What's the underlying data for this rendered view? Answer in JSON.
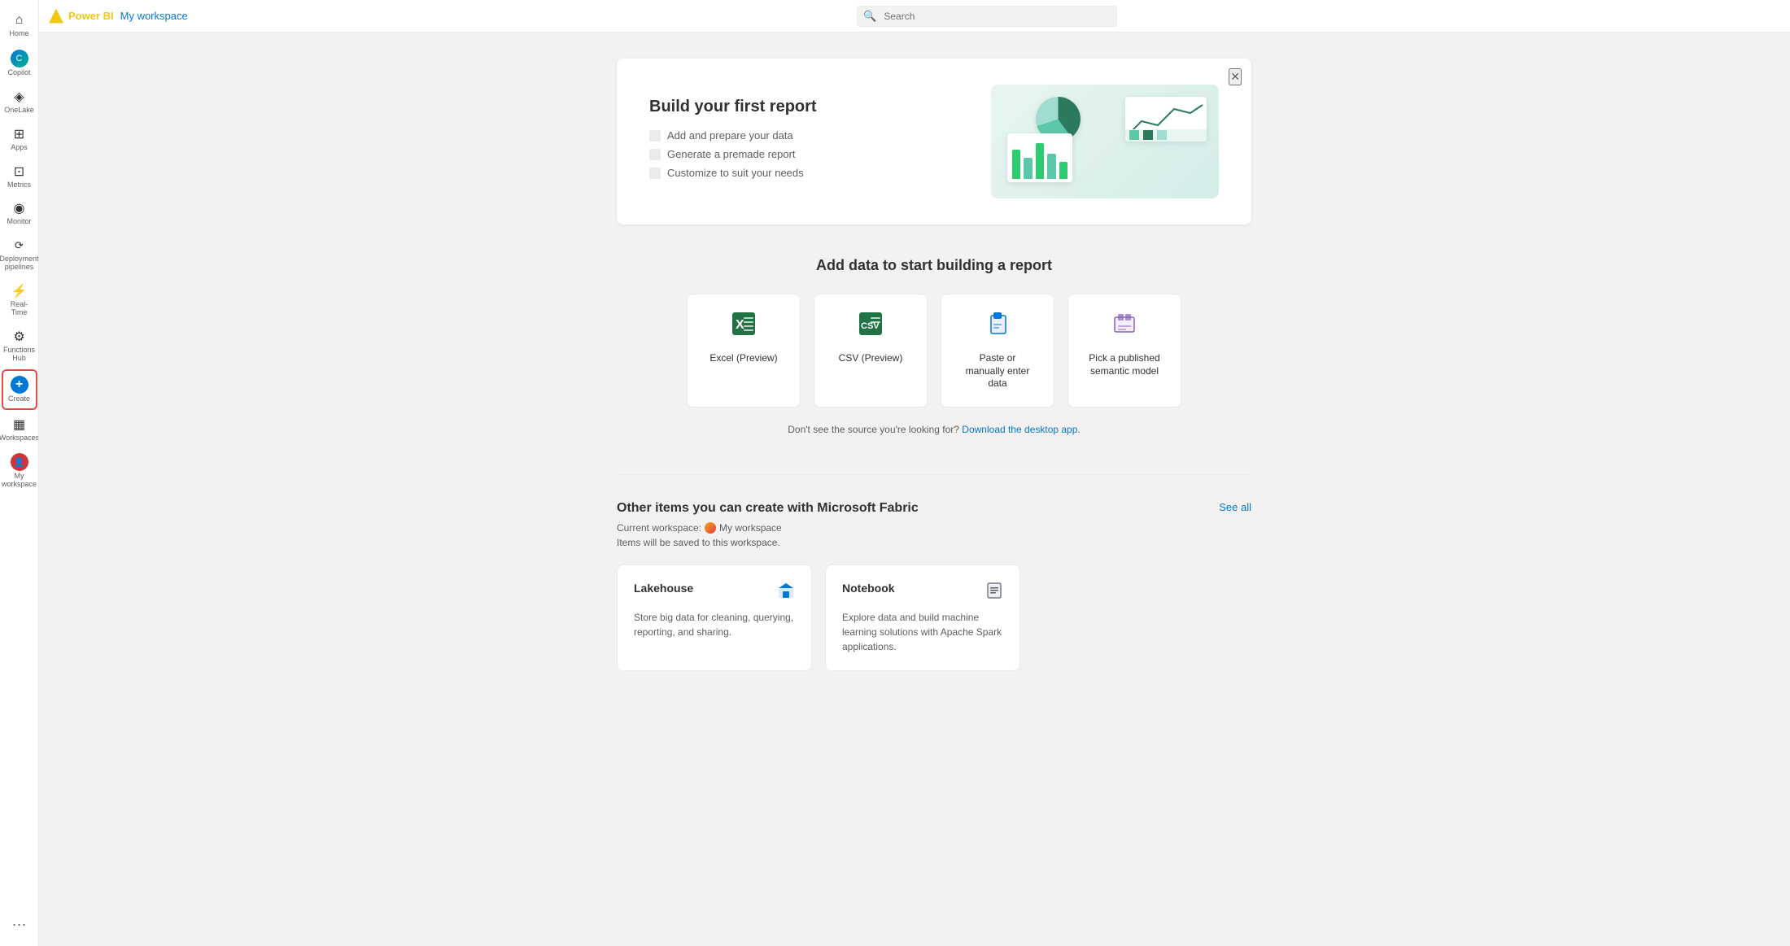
{
  "topbar": {
    "brand": "Power BI",
    "workspace": "My workspace",
    "search_placeholder": "Search"
  },
  "sidebar": {
    "items": [
      {
        "id": "home",
        "label": "Home",
        "icon": "⌂"
      },
      {
        "id": "copilot",
        "label": "Copilot",
        "icon": "✦"
      },
      {
        "id": "onelake",
        "label": "OneLake",
        "icon": "◈"
      },
      {
        "id": "apps",
        "label": "Apps",
        "icon": "⊞"
      },
      {
        "id": "metrics",
        "label": "Metrics",
        "icon": "⊡"
      },
      {
        "id": "monitor",
        "label": "Monitor",
        "icon": "◉"
      },
      {
        "id": "deployment",
        "label": "Deployment pipelines",
        "icon": "⟳"
      },
      {
        "id": "realtime",
        "label": "Real-Time",
        "icon": "⚡"
      },
      {
        "id": "functions",
        "label": "Functions Hub",
        "icon": "⚙"
      },
      {
        "id": "create",
        "label": "Create",
        "icon": "+"
      },
      {
        "id": "workspaces",
        "label": "Workspaces",
        "icon": "▦"
      },
      {
        "id": "myworkspace",
        "label": "My workspace",
        "icon": "👤"
      }
    ],
    "dots_label": "..."
  },
  "hero": {
    "title": "Build your first report",
    "features": [
      "Add and prepare your data",
      "Generate a premade report",
      "Customize to suit your needs"
    ],
    "close_label": "✕"
  },
  "data_section": {
    "title": "Add data to start building a report",
    "cards": [
      {
        "id": "excel",
        "label": "Excel (Preview)",
        "icon": "📗"
      },
      {
        "id": "csv",
        "label": "CSV (Preview)",
        "icon": "📗"
      },
      {
        "id": "paste",
        "label": "Paste or manually enter data",
        "icon": "📋"
      },
      {
        "id": "semantic",
        "label": "Pick a published semantic model",
        "icon": "📦"
      }
    ],
    "hint_text": "Don't see the source you're looking for?",
    "download_link": "Download the desktop app",
    "hint_end": "."
  },
  "other_section": {
    "title": "Other items you can create with Microsoft Fabric",
    "see_all": "See all",
    "current_workspace_label": "Current workspace:",
    "workspace_name": "My workspace",
    "workspace_note": "Items will be saved to this workspace.",
    "cards": [
      {
        "id": "lakehouse",
        "title": "Lakehouse",
        "icon": "🏠",
        "description": "Store big data for cleaning, querying, reporting, and sharing."
      },
      {
        "id": "notebook",
        "title": "Notebook",
        "icon": "📄",
        "description": "Explore data and build machine learning solutions with Apache Spark applications."
      }
    ]
  }
}
